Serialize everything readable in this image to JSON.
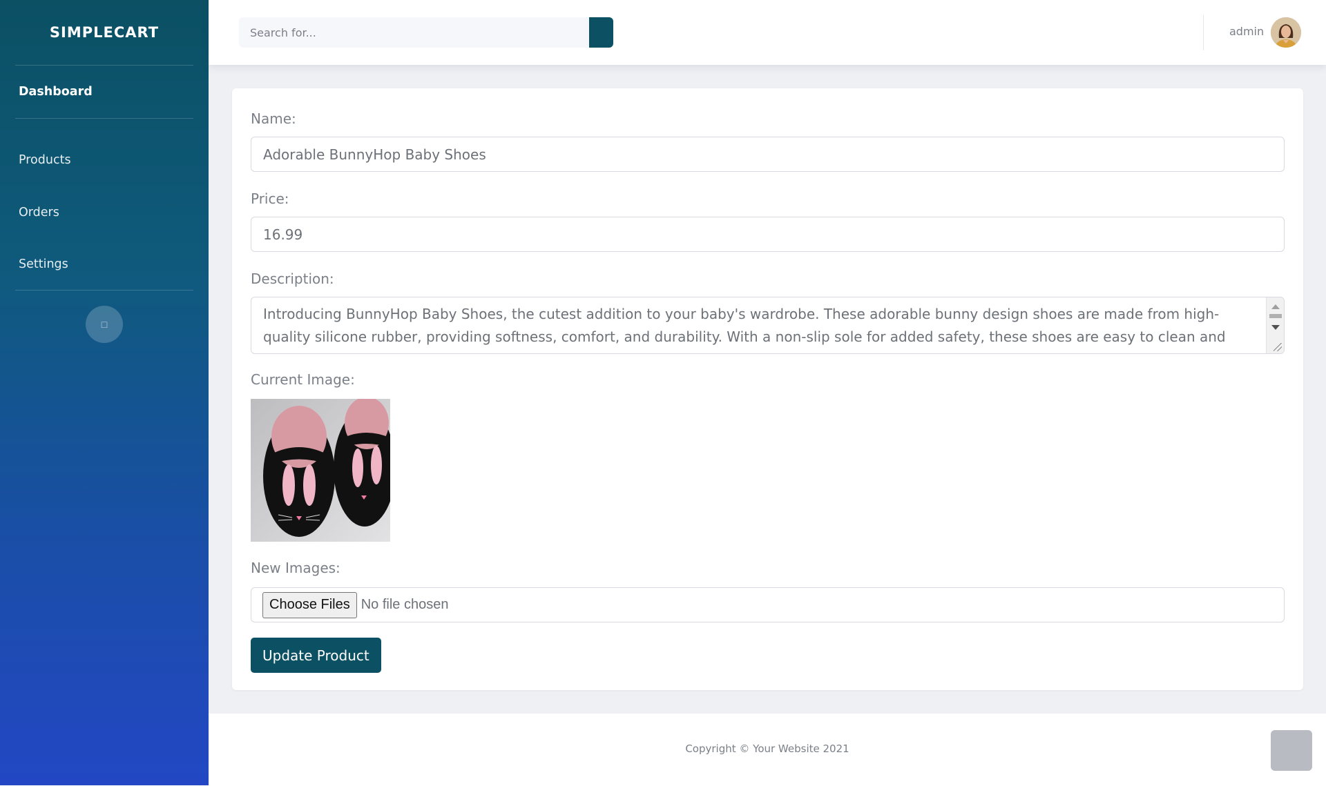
{
  "sidebar": {
    "brand": "SIMPLECART",
    "items": [
      {
        "label": "Dashboard"
      },
      {
        "label": "Products"
      },
      {
        "label": "Orders"
      },
      {
        "label": "Settings"
      }
    ],
    "toggle_glyph": "□"
  },
  "topbar": {
    "search_placeholder": "Search for...",
    "user_name": "admin"
  },
  "form": {
    "name_label": "Name:",
    "name_value": "Adorable BunnyHop Baby Shoes",
    "price_label": "Price:",
    "price_value": "16.99",
    "description_label": "Description:",
    "description_value": "Introducing BunnyHop Baby Shoes, the cutest addition to your baby's wardrobe. These adorable bunny design shoes are made from high-quality silicone rubber, providing softness, comfort, and durability. With a non-slip sole for added safety, these shoes are easy to clean and maintain, making",
    "current_image_label": "Current Image:",
    "new_images_label": "New Images:",
    "choose_files_label": "Choose Files",
    "no_file_text": "No file chosen",
    "update_button": "Update Product"
  },
  "footer": {
    "copyright": "Copyright © Your Website 2021"
  },
  "colors": {
    "primary": "#0b5063",
    "sidebar_top": "#0b5063",
    "sidebar_bottom": "#2347c4"
  }
}
